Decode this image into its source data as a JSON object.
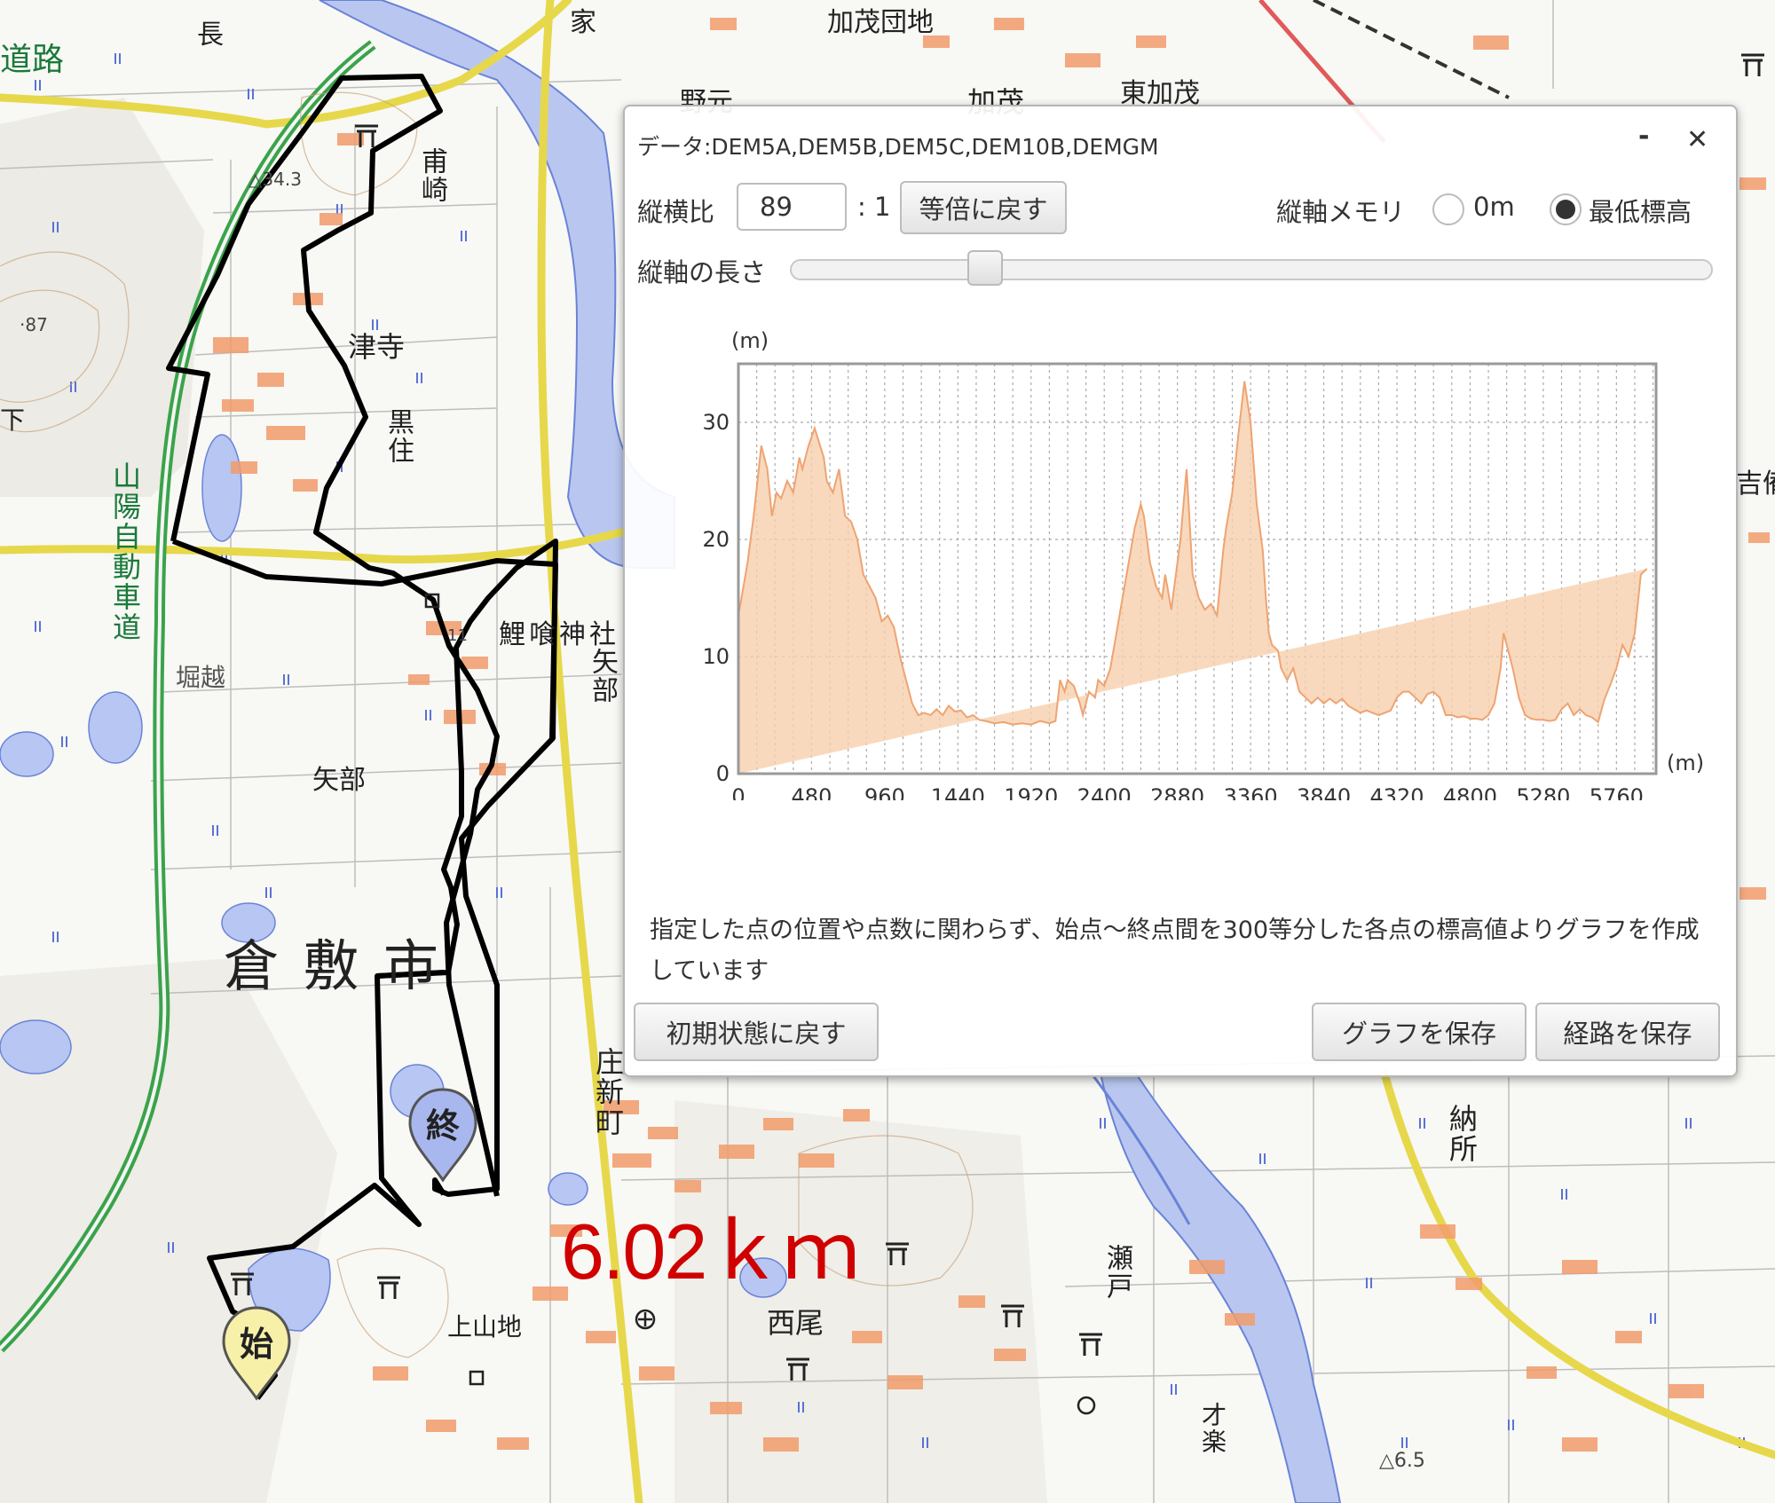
{
  "map": {
    "place_labels": [
      {
        "id": "road-top",
        "text": "道路"
      },
      {
        "id": "naga",
        "text": "長"
      },
      {
        "id": "yaoe",
        "text": "家"
      },
      {
        "id": "kamo-danchi",
        "text": "加茂団地"
      },
      {
        "id": "nomoto",
        "text": "野元"
      },
      {
        "id": "kamo",
        "text": "加茂"
      },
      {
        "id": "higashi-kamo",
        "text": "東加茂"
      },
      {
        "id": "hozaki",
        "text": "甫崎"
      },
      {
        "id": "tsudera",
        "text": "津寺"
      },
      {
        "id": "kurozumi",
        "text": "黒住"
      },
      {
        "id": "koi-shrine",
        "text": "鯉喰神社"
      },
      {
        "id": "yabe-vert",
        "text": "矢部"
      },
      {
        "id": "horikoshi",
        "text": "堀越"
      },
      {
        "id": "yabe",
        "text": "矢部"
      },
      {
        "id": "kurashiki",
        "text": "倉敷市"
      },
      {
        "id": "shoshinmachi",
        "text": "庄新町"
      },
      {
        "id": "nosho",
        "text": "納所"
      },
      {
        "id": "seto",
        "text": "瀬戸"
      },
      {
        "id": "kamiyamaji",
        "text": "上山地"
      },
      {
        "id": "nishio",
        "text": "西尾"
      },
      {
        "id": "sairaku",
        "text": "才楽"
      },
      {
        "id": "kibi",
        "text": "吉備"
      },
      {
        "id": "elev-343",
        "text": "△34.3"
      },
      {
        "id": "elev-87",
        "text": "·87"
      },
      {
        "id": "elev-11",
        "text": "11"
      },
      {
        "id": "elev-65",
        "text": "△6.5"
      },
      {
        "id": "shita",
        "text": "下"
      }
    ],
    "expressway_label": "山陽自動車道",
    "distance_label": "6.02ｋｍ",
    "start_marker": "始",
    "end_marker": "終",
    "colors": {
      "route": "#000000",
      "expressway": "#3aa34a",
      "river": "#a8b8ec",
      "national_road": "#f2e96a",
      "buildings": "#f29c6b",
      "distance": "#d00000"
    }
  },
  "dialog": {
    "title": "データ:DEM5A,DEM5B,DEM5C,DEM10B,DEMGM",
    "minimize_icon": "‐",
    "close_icon": "✕",
    "ratio_label": "縦横比",
    "ratio_value": "89",
    "ratio_suffix": ": 1",
    "reset_ratio_button": "等倍に戻す",
    "axis_memory_label": "縦軸メモリ",
    "radio_zero_label": "0m",
    "radio_min_label": "最低標高",
    "radio_selected": "min",
    "axis_length_label": "縦軸の長さ",
    "axis_length_slider": 0.2,
    "note": "指定した点の位置や点数に関わらず、始点～終点間を300等分した各点の標高値よりグラフを作成しています",
    "reset_button": "初期状態に戻す",
    "save_graph_button": "グラフを保存",
    "save_route_button": "経路を保存"
  },
  "chart_data": {
    "type": "area",
    "ylabel": "(m)",
    "xlabel": "(m)",
    "xlim": [
      0,
      6020
    ],
    "ylim": [
      0,
      35
    ],
    "x_ticks": [
      0,
      480,
      960,
      1440,
      1920,
      2400,
      2880,
      3360,
      3840,
      4320,
      4800,
      5280,
      5760
    ],
    "y_ticks": [
      0,
      10,
      20,
      30
    ],
    "grid": true,
    "fill_color": "#f7cfac",
    "line_color": "#eea472",
    "x": [
      0,
      60,
      100,
      150,
      190,
      220,
      250,
      280,
      320,
      360,
      400,
      420,
      460,
      500,
      560,
      580,
      620,
      660,
      700,
      740,
      780,
      820,
      860,
      900,
      940,
      980,
      1020,
      1060,
      1100,
      1140,
      1180,
      1220,
      1260,
      1300,
      1340,
      1380,
      1420,
      1460,
      1500,
      1540,
      1580,
      1620,
      1680,
      1740,
      1800,
      1860,
      1920,
      1980,
      2040,
      2080,
      2110,
      2140,
      2160,
      2200,
      2240,
      2260,
      2300,
      2340,
      2360,
      2400,
      2440,
      2480,
      2520,
      2560,
      2600,
      2640,
      2660,
      2700,
      2740,
      2780,
      2800,
      2840,
      2860,
      2900,
      2940,
      2980,
      3000,
      3020,
      3060,
      3100,
      3140,
      3180,
      3200,
      3240,
      3280,
      3320,
      3360,
      3400,
      3440,
      3460,
      3480,
      3500,
      3540,
      3560,
      3600,
      3640,
      3680,
      3720,
      3760,
      3800,
      3840,
      3880,
      3920,
      3960,
      4000,
      4040,
      4080,
      4120,
      4160,
      4200,
      4240,
      4280,
      4320,
      4360,
      4400,
      4440,
      4480,
      4520,
      4560,
      4600,
      4640,
      4680,
      4720,
      4760,
      4800,
      4840,
      4880,
      4920,
      4960,
      5000,
      5020,
      5040,
      5080,
      5120,
      5160,
      5200,
      5240,
      5280,
      5320,
      5360,
      5400,
      5440,
      5480,
      5520,
      5560,
      5600,
      5640,
      5680,
      5720,
      5760,
      5800,
      5840,
      5880,
      5920,
      5960,
      6020
    ],
    "y": [
      13.5,
      18,
      22,
      28,
      26,
      22,
      24,
      23.5,
      25,
      24,
      27,
      26,
      28,
      29.5,
      27,
      25,
      24,
      26,
      22,
      21.5,
      20,
      17,
      16,
      15,
      13,
      13.5,
      12.5,
      10,
      8,
      6,
      5,
      5.2,
      5,
      5.5,
      5,
      5.8,
      5.3,
      5.4,
      4.8,
      5,
      4.6,
      4.5,
      4.3,
      4.4,
      4.2,
      4.3,
      4.2,
      4.5,
      4.3,
      4.5,
      8,
      7,
      8,
      7.5,
      6,
      5,
      7,
      6.5,
      8,
      7.5,
      9,
      12,
      15,
      18,
      21,
      23,
      22,
      18,
      16,
      15,
      17,
      14,
      16,
      20,
      26,
      17,
      16,
      15,
      14,
      14.5,
      13.5,
      19,
      21,
      24,
      29,
      33.5,
      30,
      23,
      19,
      15,
      12,
      11,
      10.5,
      9,
      8,
      9,
      7,
      6.5,
      6,
      6.5,
      6,
      6.4,
      6,
      6.4,
      5.8,
      5.5,
      5.2,
      5.4,
      5.2,
      5,
      5.2,
      5.4,
      6.5,
      7,
      7,
      6.5,
      6,
      6.8,
      7,
      6.5,
      5,
      5,
      4.8,
      4.9,
      4.7,
      4.7,
      4.6,
      5,
      6,
      9,
      12,
      11,
      9,
      6.5,
      5,
      4.7,
      4.6,
      4.6,
      4.5,
      4.6,
      5.5,
      6,
      5,
      5.5,
      5,
      4.8,
      4.4,
      6.3,
      7.6,
      9,
      11,
      10,
      12,
      17,
      17.5
    ]
  }
}
